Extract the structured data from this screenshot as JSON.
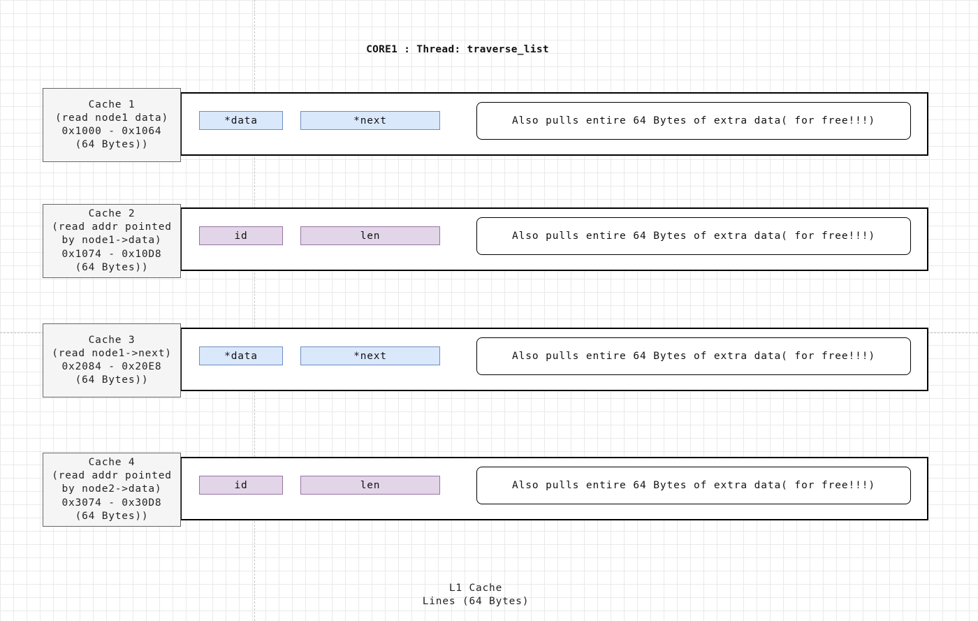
{
  "title": "CORE1 : Thread: traverse_list",
  "rows": [
    {
      "label_lines": [
        "Cache 1",
        "(read node1 data)",
        "0x1000 - 0x1064",
        "(64 Bytes))"
      ],
      "fields": [
        "*data",
        "*next"
      ],
      "field_color": "#dae8fc",
      "extra": "Also pulls entire 64 Bytes of extra data( for free!!!)"
    },
    {
      "label_lines": [
        "Cache 2",
        "(read addr pointed",
        "by node1->data)",
        "0x1074 - 0x10D8",
        "(64 Bytes))"
      ],
      "fields": [
        "id",
        "len"
      ],
      "field_color": "#e1d5e7",
      "extra": "Also pulls entire 64 Bytes of extra data( for free!!!)"
    },
    {
      "label_lines": [
        "Cache 3",
        "(read node1->next)",
        "0x2084 - 0x20E8",
        "(64 Bytes))"
      ],
      "fields": [
        "*data",
        "*next"
      ],
      "field_color": "#dae8fc",
      "extra": "Also pulls entire 64 Bytes of extra data( for free!!!)"
    },
    {
      "label_lines": [
        "Cache 4",
        "(read addr pointed",
        "by node2->data)",
        "0x3074 - 0x30D8",
        "(64 Bytes))"
      ],
      "fields": [
        "id",
        "len"
      ],
      "field_color": "#e1d5e7",
      "extra": "Also pulls entire 64 Bytes of extra data( for free!!!)"
    }
  ],
  "footer": {
    "line1": "L1 Cache",
    "line2": "Lines (64 Bytes)"
  }
}
